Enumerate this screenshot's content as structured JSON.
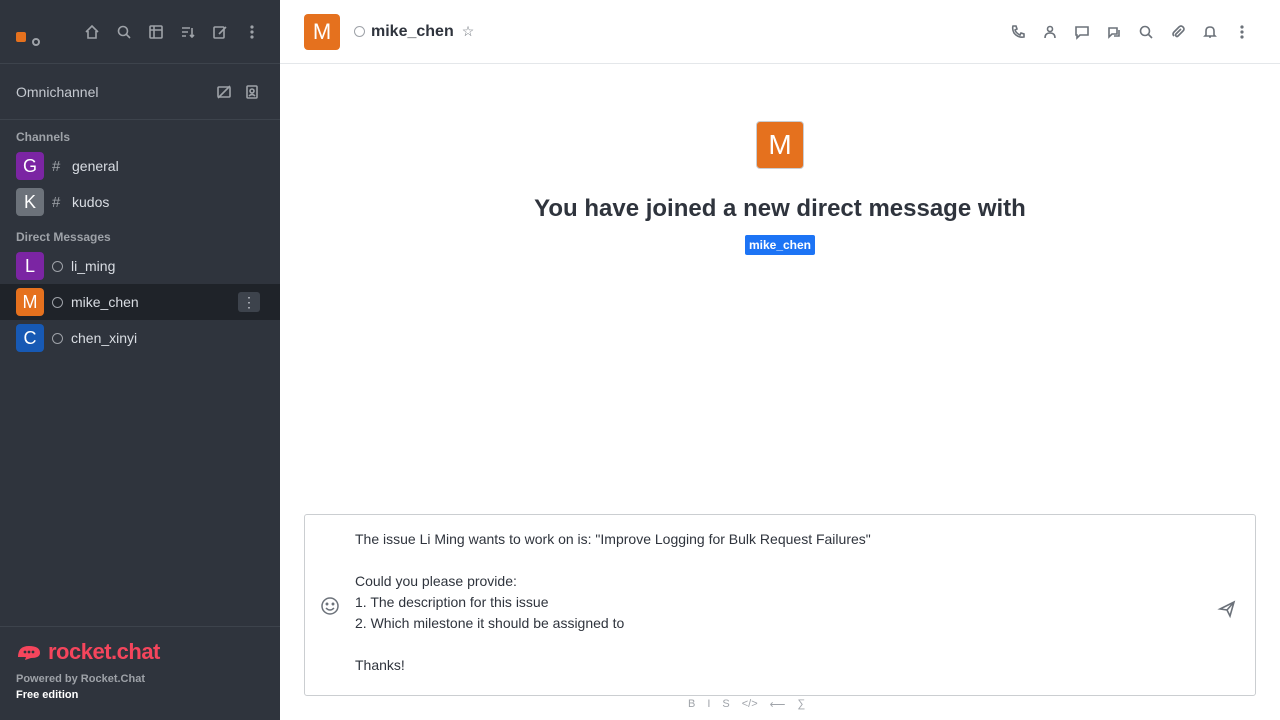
{
  "sidebar": {
    "omnichannel_label": "Omnichannel",
    "sections": {
      "channels": "Channels",
      "direct_messages": "Direct Messages"
    },
    "channels": [
      {
        "avatar": "G",
        "name": "general",
        "color": "#7b25a3"
      },
      {
        "avatar": "K",
        "name": "kudos",
        "color": "#6c727a"
      }
    ],
    "direct_messages": [
      {
        "avatar": "L",
        "name": "li_ming",
        "color": "#7b25a3"
      },
      {
        "avatar": "M",
        "name": "mike_chen",
        "color": "#e5711e"
      },
      {
        "avatar": "C",
        "name": "chen_xinyi",
        "color": "#1759b4"
      }
    ],
    "footer": {
      "logo_text": "rocket.chat",
      "powered_by": "Powered by Rocket.Chat",
      "edition": "Free edition"
    }
  },
  "header": {
    "avatar": "M",
    "username": "mike_chen"
  },
  "welcome": {
    "avatar": "M",
    "title": "You have joined a new direct message with",
    "mention": "mike_chen"
  },
  "composer": {
    "text": "The issue Li Ming wants to work on is: \"Improve Logging for Bulk Request Failures\"\n\nCould you please provide:\n1. The description for this issue\n2. Which milestone it should be assigned to\n\nThanks!"
  },
  "format_bar": {
    "bold": "B",
    "italic": "I",
    "strike": "S",
    "code": "</>",
    "link": "⟵",
    "formula": "∑"
  },
  "colors": {
    "sidebar_bg": "#2f343d",
    "brand_red": "#f5455c",
    "mention_blue": "#1d74f5",
    "user_orange": "#e5711e"
  }
}
